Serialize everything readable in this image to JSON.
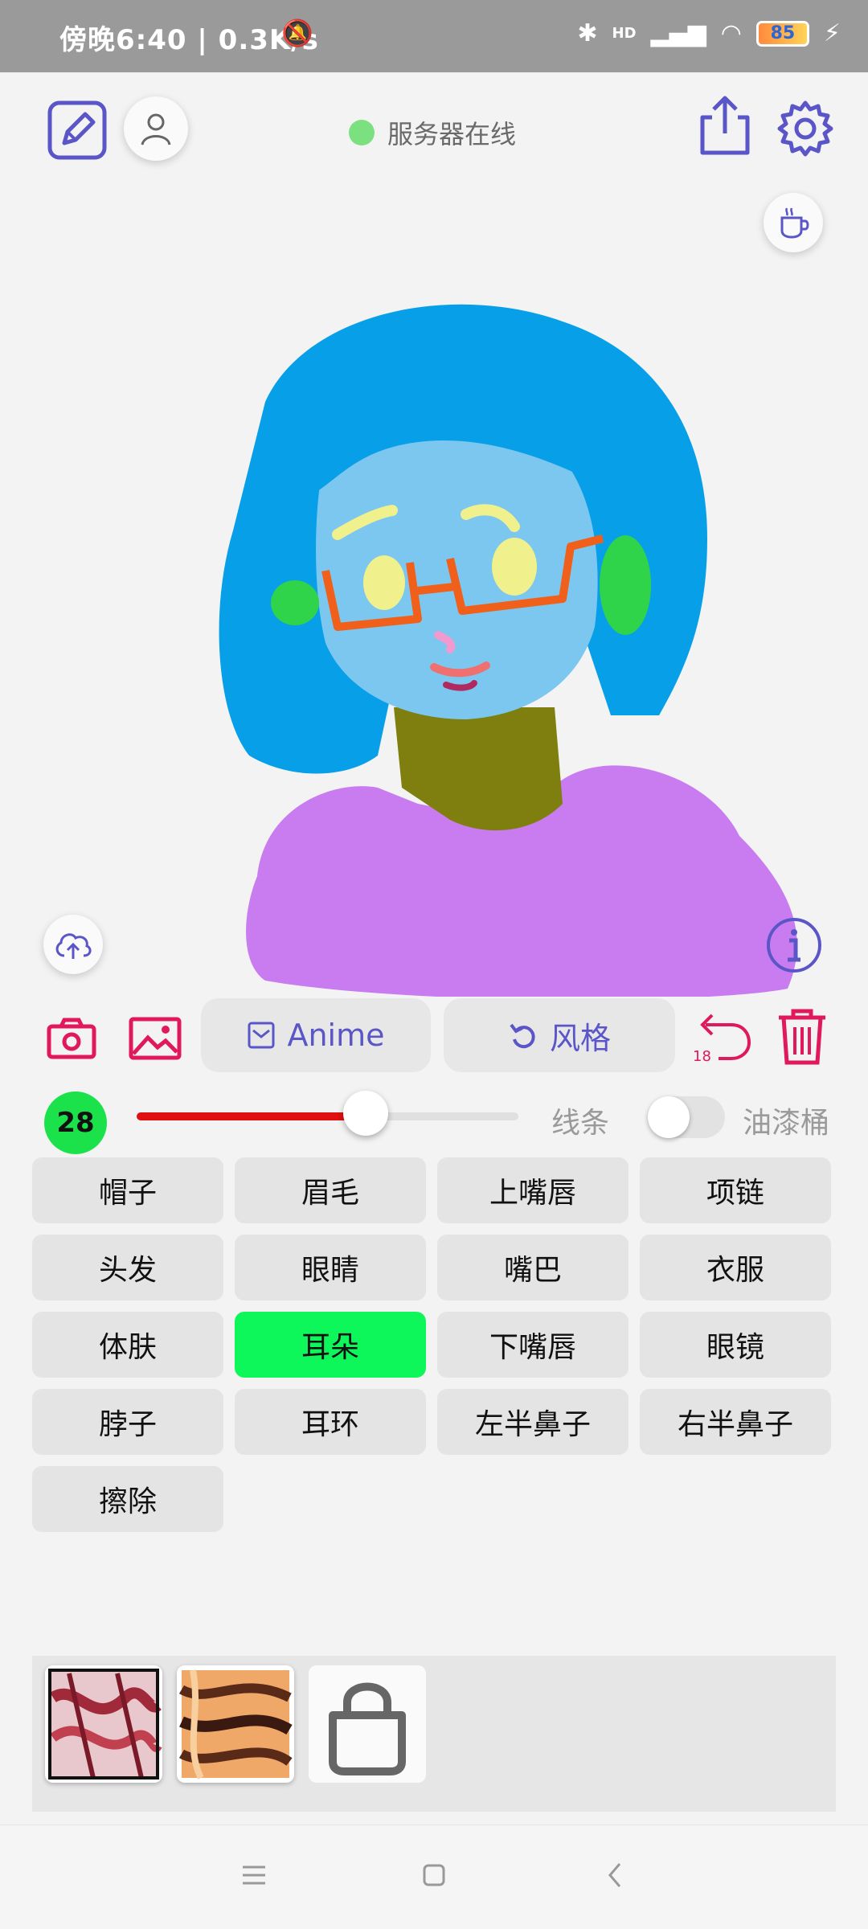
{
  "statusbar": {
    "time": "傍晚6:40 | 0.3K/s",
    "network": "HD",
    "battery": "85"
  },
  "header": {
    "server_status": "服务器在线"
  },
  "toolbar": {
    "anime_label": "Anime",
    "style_label": "风格",
    "undo_count": "18"
  },
  "brush": {
    "size": "28",
    "level": 0.6,
    "line_label": "线条",
    "bucket_label": "油漆桶"
  },
  "parts": [
    {
      "label": "帽子",
      "active": false
    },
    {
      "label": "眉毛",
      "active": false
    },
    {
      "label": "上嘴唇",
      "active": false
    },
    {
      "label": "项链",
      "active": false
    },
    {
      "label": "头发",
      "active": false
    },
    {
      "label": "眼睛",
      "active": false
    },
    {
      "label": "嘴巴",
      "active": false
    },
    {
      "label": "衣服",
      "active": false
    },
    {
      "label": "体肤",
      "active": false
    },
    {
      "label": "耳朵",
      "active": true
    },
    {
      "label": "下嘴唇",
      "active": false
    },
    {
      "label": "眼镜",
      "active": false
    },
    {
      "label": "脖子",
      "active": false
    },
    {
      "label": "耳环",
      "active": false
    },
    {
      "label": "左半鼻子",
      "active": false
    },
    {
      "label": "右半鼻子",
      "active": false
    },
    {
      "label": "擦除",
      "active": false
    }
  ],
  "colors": {
    "accent": "#5a56c8",
    "danger": "#e0185c",
    "active_part": "#0ef75a",
    "slider_fill": "#e01010",
    "hair": "#079fe8",
    "skin": "#7cc7f0",
    "clothes": "#c87cf0",
    "neck": "#7f7f10"
  },
  "icons": [
    "edit-icon",
    "user-icon",
    "share-icon",
    "settings-icon",
    "coffee-icon",
    "upload-icon",
    "info-icon",
    "camera-icon",
    "image-icon",
    "undo-icon",
    "trash-icon",
    "bag-icon"
  ]
}
